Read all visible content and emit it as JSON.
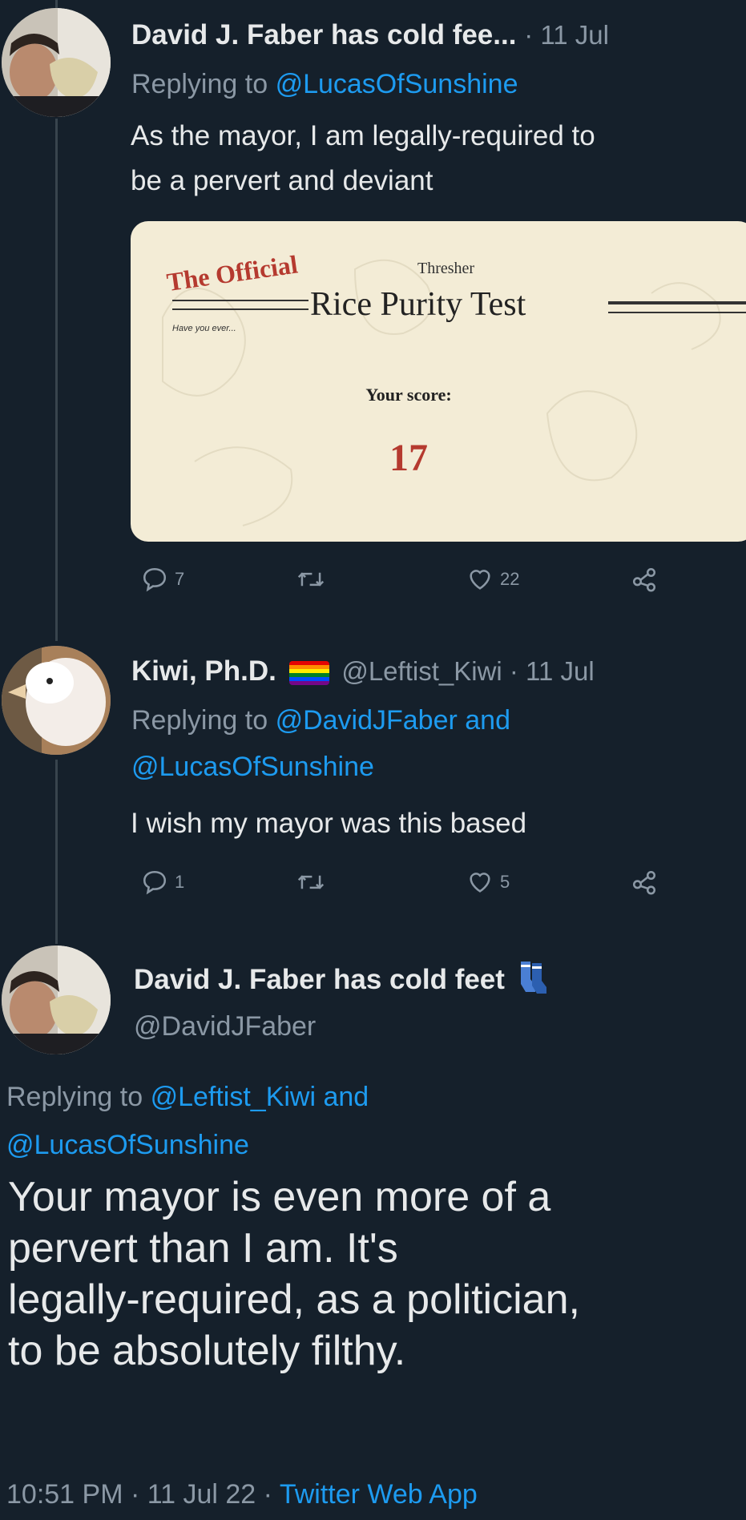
{
  "colors": {
    "background": "#15202b",
    "text": "#e7e9ea",
    "muted": "#8b98a5",
    "link": "#1d9bf0",
    "card": "#f3ecd6",
    "score": "#b53a2f"
  },
  "tweet1": {
    "name": "David J. Faber has cold fee...",
    "date": "· 11 Jul",
    "replying_prefix": "Replying to",
    "replying_mention": "@LucasOfSunshine",
    "text_line1": "As the mayor, I am legally-required to",
    "text_line2": "be a pervert and deviant",
    "card": {
      "the_official": "The Official",
      "thresher": "Thresher",
      "title": "Rice Purity Test",
      "have_you_ever": "Have you ever...",
      "your_score_label": "Your score:",
      "score": "17"
    },
    "replies": "7",
    "likes": "22"
  },
  "tweet2": {
    "name": "Kiwi, Ph.D.",
    "handle_date": "@Leftist_Kiwi · 11 Jul",
    "replying_prefix": "Replying to",
    "replying_mention1": "@DavidJFaber and",
    "replying_mention2": "@LucasOfSunshine",
    "text": "I wish my mayor was this based",
    "replies": "1",
    "likes": "5"
  },
  "tweet3": {
    "name": "David J. Faber has cold feet",
    "name_emoji_icon": "socks-icon",
    "handle": "@DavidJFaber",
    "replying_prefix": "Replying to",
    "replying_mention1": "@Leftist_Kiwi and",
    "replying_mention2": "@LucasOfSunshine",
    "text_line1": "Your mayor is even more of a",
    "text_line2": "pervert than I am. It's",
    "text_line3": "legally-required, as a politician,",
    "text_line4": "to be absolutely filthy.",
    "timestamp": "10:51 PM · 11 Jul 22 ·",
    "source": "Twitter Web App"
  }
}
